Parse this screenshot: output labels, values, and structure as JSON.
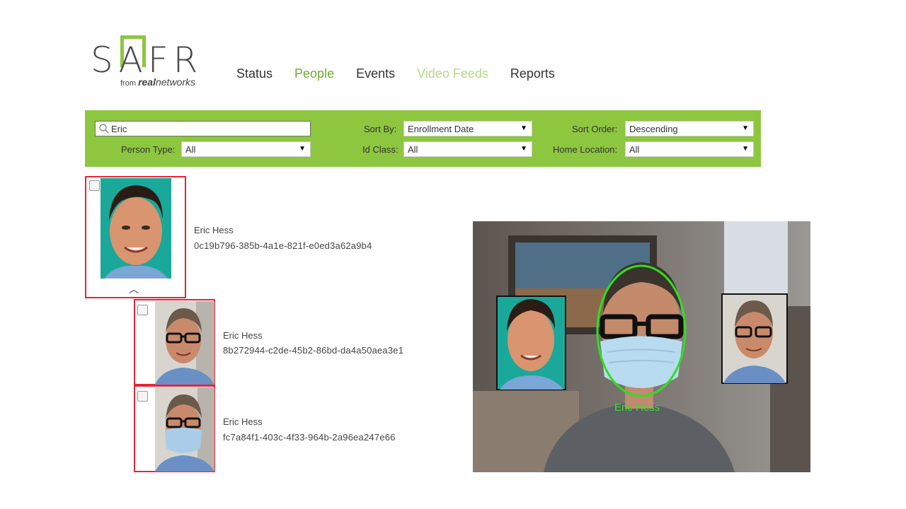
{
  "logo": {
    "brand": "SAFR",
    "sub_prefix": "from",
    "sub_brand_bold": "real",
    "sub_brand_italic": "networks"
  },
  "nav": {
    "items": [
      "Status",
      "People",
      "Events",
      "Video Feeds",
      "Reports"
    ],
    "active": "People"
  },
  "filters": {
    "search_value": "Eric",
    "sort_by_label": "Sort By:",
    "sort_by_value": "Enrollment Date",
    "sort_order_label": "Sort Order:",
    "sort_order_value": "Descending",
    "person_type_label": "Person Type:",
    "person_type_value": "All",
    "id_class_label": "Id Class:",
    "id_class_value": "All",
    "home_location_label": "Home Location:",
    "home_location_value": "All"
  },
  "people": [
    {
      "name": "Eric Hess",
      "id": "0c19b796-385b-4a1e-821f-e0ed3a62a9b4"
    },
    {
      "name": "Eric Hess",
      "id": "8b272944-c2de-45b2-86bd-da4a50aea3e1"
    },
    {
      "name": "Eric Hess",
      "id": "fc7a84f1-403c-4f33-964b-2a96ea247e66"
    }
  ],
  "video_feed": {
    "recognized_label": "Eric Hess"
  },
  "colors": {
    "accent_green": "#8dc63f",
    "nav_active": "#6fab2d",
    "card_border": "#e32636",
    "detect_green": "#3adf2b"
  }
}
